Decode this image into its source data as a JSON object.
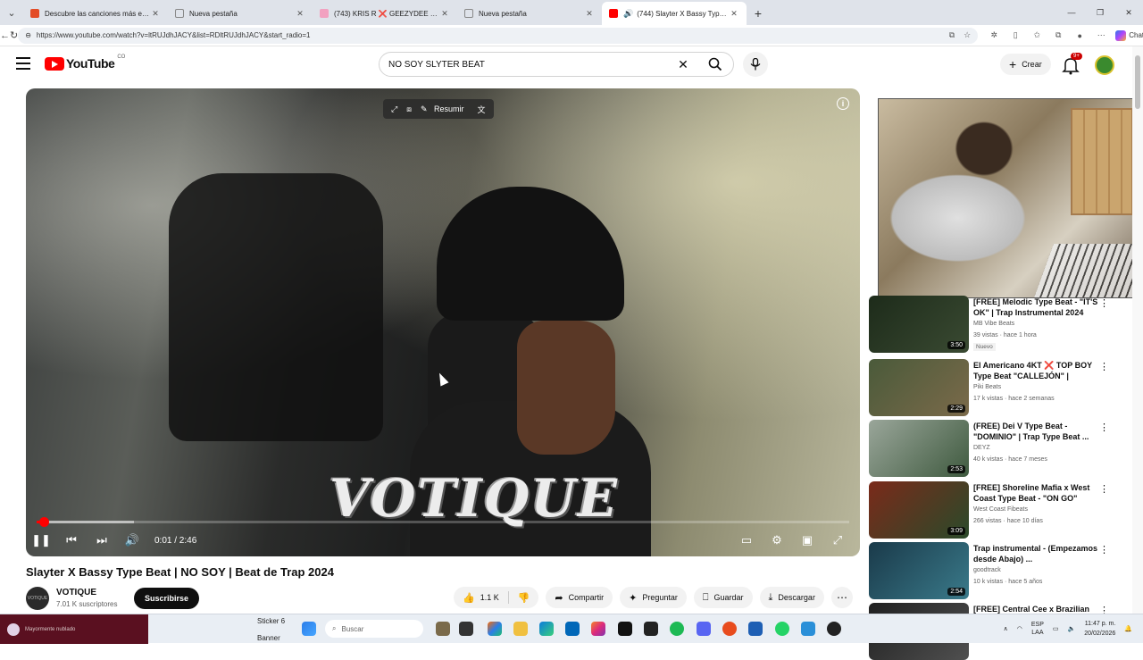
{
  "browser": {
    "tabs": [
      {
        "title": "Descubre las canciones más escuc",
        "color": "#e34c26",
        "active": false
      },
      {
        "title": "Nueva pestaña",
        "color": "#ffffff",
        "active": false
      },
      {
        "title": "(743) KRIS R ❌ GEEZYDEE - BOB",
        "color": "#f2a1c0",
        "active": false
      },
      {
        "title": "Nueva pestaña",
        "color": "#ffffff",
        "active": false
      },
      {
        "title": "(744) Slayter X Bassy Type Beat",
        "color": "#ff0000",
        "active": true
      }
    ],
    "url": "https://www.youtube.com/watch?v=ltRUJdhJACY&list=RDltRUJdhJACY&start_radio=1",
    "copilot_label": "Chat"
  },
  "youtube": {
    "logo_text": "YouTube",
    "country_code": "CO",
    "search_query": "NO SOY SLYTER BEAT",
    "create_label": "Crear",
    "notif_count": "9+"
  },
  "player": {
    "overlay_text": "VOTIQUE",
    "toolbar_resumir": "Resumir",
    "time": "0:01 / 2:46",
    "progress_fraction": 0.006,
    "buffered_fraction": 0.12
  },
  "video": {
    "title": "Slayter X Bassy Type Beat | NO SOY | Beat de Trap 2024",
    "channel": "VOTIQUE",
    "subscribers": "7.01 K suscriptores",
    "subscribe_label": "Suscribirse",
    "likes": "1.1 K",
    "share_label": "Compartir",
    "ask_label": "Preguntar",
    "save_label": "Guardar",
    "download_label": "Descargar",
    "channel_avatar_text": "VOTIQUE"
  },
  "recommendations": [
    {
      "title": "[FREE] Melodic Type Beat - \"IT'S OK\" | Trap Instrumental 2024",
      "channel": "MB Vibe Beats",
      "meta": "39 vistas · hace 1 hora",
      "duration": "3:50",
      "new": "Nuevo",
      "thumb": [
        "#1d2b1a",
        "#3a4a32"
      ]
    },
    {
      "title": "El Americano 4KT ❌ TOP BOY Type Beat \"CALLEJÓN\" | Detroi...",
      "channel": "Piki Beats",
      "meta": "17 k vistas · hace 2 semanas",
      "duration": "2:29",
      "new": "",
      "thumb": [
        "#4a5a3a",
        "#7b6a4a"
      ]
    },
    {
      "title": "(FREE) Dei V Type Beat - \"DOMINIO\" | Trap Type Beat ...",
      "channel": "DEYZ",
      "meta": "40 k vistas · hace 7 meses",
      "duration": "2:53",
      "new": "",
      "thumb": [
        "#9aa69a",
        "#3f5a3f"
      ]
    },
    {
      "title": "[FREE] Shoreline Mafia x West Coast Type Beat - \"ON GO\"",
      "channel": "West Coast Fibeats",
      "meta": "266 vistas · hace 10 días",
      "duration": "3:09",
      "new": "",
      "thumb": [
        "#7a2a1a",
        "#2a4a2a"
      ]
    },
    {
      "title": "Trap instrumental - (Empezamos desde Abajo) ...",
      "channel": "goodtrack",
      "meta": "10 k vistas · hace 5 años",
      "duration": "2:54",
      "new": "",
      "thumb": [
        "#1a3a4a",
        "#3a7a8a"
      ]
    },
    {
      "title": "[FREE] Central Cee x Brazilian",
      "channel": "",
      "meta": "",
      "duration": "",
      "new": "",
      "thumb": [
        "#202020",
        "#505050"
      ]
    }
  ],
  "taskbar": {
    "weather_text": "Mayormente nublado",
    "sticker_label": "Sticker 6",
    "banner_label": "Banner",
    "search_placeholder": "Buscar",
    "lang": "ESP",
    "lang2": "LAA",
    "time": "11:47 p. m.",
    "date": "20/02/2026"
  }
}
